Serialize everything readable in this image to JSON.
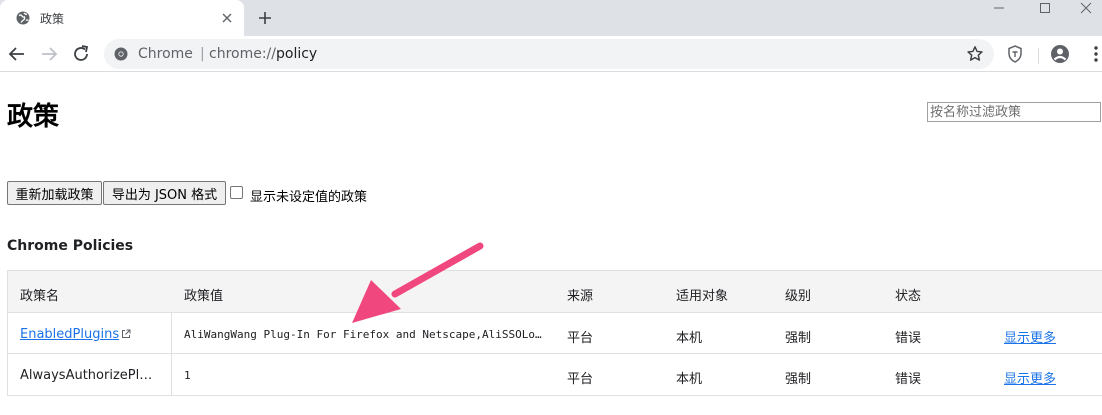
{
  "browser": {
    "tab_title": "政策",
    "url_site": "Chrome",
    "url_separator": "|",
    "url_scheme": "chrome://",
    "url_host": "policy"
  },
  "page": {
    "title": "政策",
    "filter_placeholder": "按名称过滤政策",
    "reload_button": "重新加载政策",
    "export_button": "导出为 JSON 格式",
    "show_unset_label": "显示未设定值的政策",
    "section_title": "Chrome Policies"
  },
  "table": {
    "headers": [
      "政策名",
      "政策值",
      "来源",
      "适用对象",
      "级别",
      "状态"
    ],
    "rows": [
      {
        "name": "EnabledPlugins",
        "value": "AliWangWang Plug-In For Firefox and Netscape,AliSSOLogin plugin",
        "source": "平台",
        "scope": "本机",
        "level": "强制",
        "status": "错误",
        "more": "显示更多"
      },
      {
        "name": "AlwaysAuthorizePlugins",
        "value": "1",
        "source": "平台",
        "scope": "本机",
        "level": "强制",
        "status": "错误",
        "more": "显示更多"
      }
    ]
  },
  "colors": {
    "link": "#1a73e8",
    "annotation_arrow": "#f0487e"
  }
}
